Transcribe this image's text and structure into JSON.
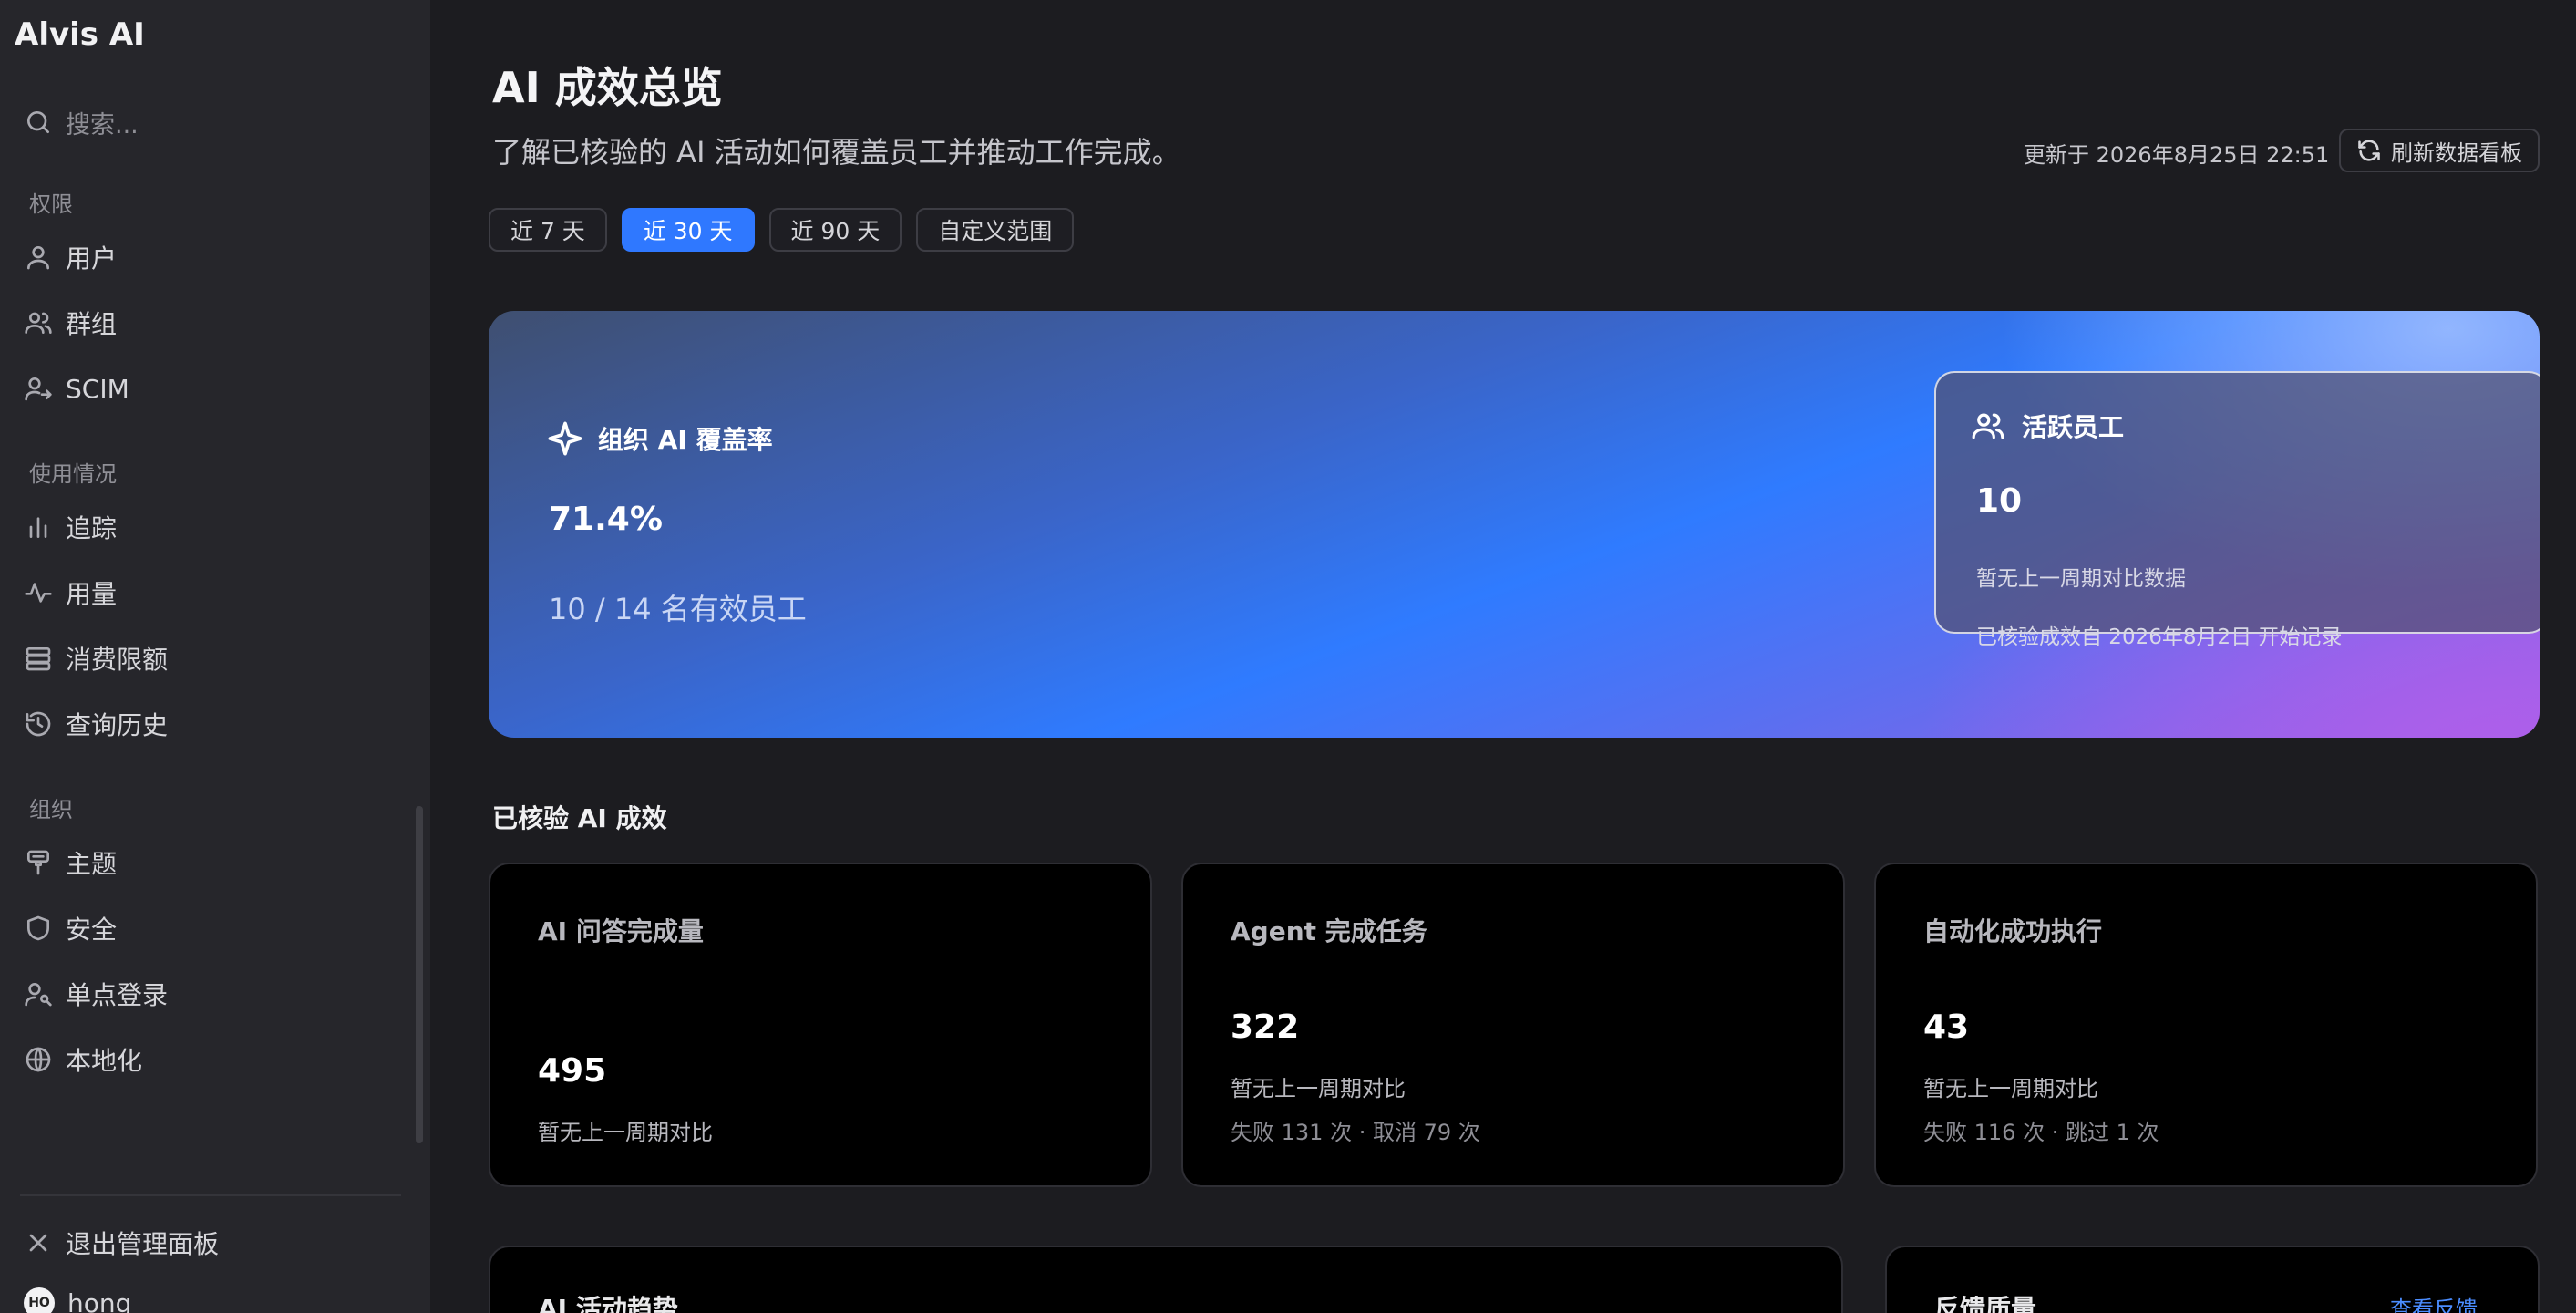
{
  "sidebar": {
    "brand": "Alvis AI",
    "search_placeholder": "搜索...",
    "sections": {
      "permissions": "权限",
      "usage": "使用情况",
      "organization": "组织"
    },
    "items": {
      "users": "用户",
      "groups": "群组",
      "scim": "SCIM",
      "tracking": "追踪",
      "consumption": "用量",
      "spend_limit": "消费限额",
      "query_history": "查询历史",
      "theme": "主题",
      "security": "安全",
      "sso": "单点登录",
      "localization": "本地化"
    },
    "exit_label": "退出管理面板",
    "user": {
      "initials": "HO",
      "name": "hong"
    }
  },
  "header": {
    "title": "AI 成效总览",
    "subtitle": "了解已核验的 AI 活动如何覆盖员工并推动工作完成。",
    "updated": "更新于 2026年8月25日 22:51",
    "refresh_label": "刷新数据看板"
  },
  "range_tabs": [
    "近 7 天",
    "近 30 天",
    "近 90 天",
    "自定义范围"
  ],
  "range_active_index": 1,
  "hero": {
    "title": "组织 AI 覆盖率",
    "value": "71.4%",
    "caption": "10 / 14 名有效员工",
    "active_card": {
      "title": "活跃员工",
      "value": "10",
      "note1": "暂无上一周期对比数据",
      "note2": "已核验成效自 2026年8月2日 开始记录"
    }
  },
  "verified": {
    "section_title": "已核验 AI 成效",
    "cards": [
      {
        "title": "AI 问答完成量",
        "value": "495",
        "sub": "暂无上一周期对比",
        "detail": ""
      },
      {
        "title": "Agent 完成任务",
        "value": "322",
        "sub": "暂无上一周期对比",
        "detail": "失败 131 次 · 取消 79 次"
      },
      {
        "title": "自动化成功执行",
        "value": "43",
        "sub": "暂无上一周期对比",
        "detail": "失败 116 次 · 跳过 1 次"
      }
    ]
  },
  "bottom": {
    "trend_title": "AI 活动趋势",
    "feedback_title": "反馈质量",
    "feedback_link": "查看反馈"
  },
  "colors": {
    "accent": "#2f78ff",
    "sidebar_bg": "#26262b",
    "main_bg": "#1c1c20",
    "card_bg": "#000000"
  }
}
